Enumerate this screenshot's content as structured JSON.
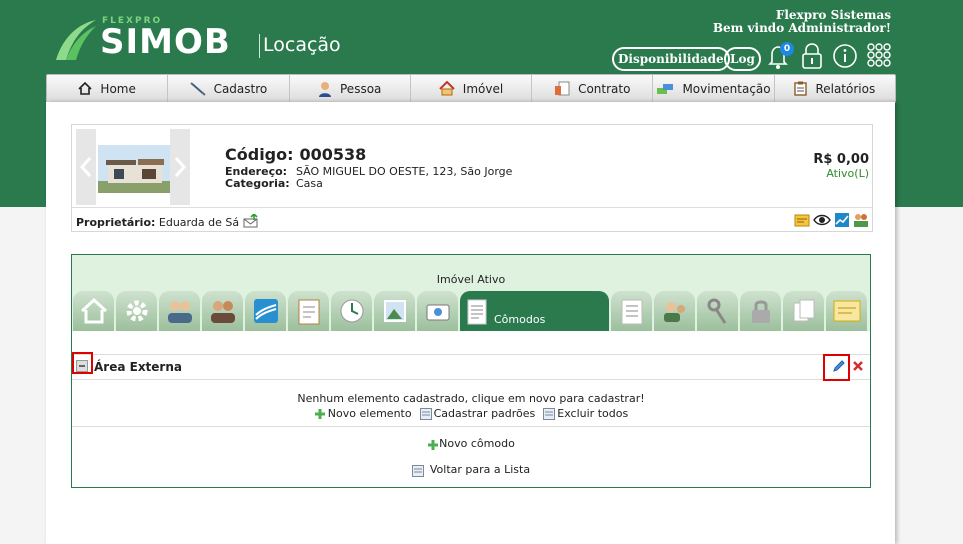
{
  "brand": {
    "flexpro": "FLEXPRO",
    "simob": "SIMOB",
    "locacao": "Locação"
  },
  "header": {
    "company": "Flexpro Sistemas",
    "welcome": "Bem vindo Administrador!",
    "disponibilidade": "Disponibilidade",
    "log": "Log",
    "notifications": "0"
  },
  "menu": [
    {
      "label": "Home",
      "icon": "home-icon"
    },
    {
      "label": "Cadastro",
      "icon": "feather-icon"
    },
    {
      "label": "Pessoa",
      "icon": "person-icon"
    },
    {
      "label": "Imóvel",
      "icon": "house-icon"
    },
    {
      "label": "Contrato",
      "icon": "contract-icon"
    },
    {
      "label": "Movimentação",
      "icon": "money-icon"
    },
    {
      "label": "Relatórios",
      "icon": "clipboard-icon"
    }
  ],
  "property": {
    "codigo_label": "Código:",
    "codigo": "000538",
    "endereco_label": "Endereço:",
    "endereco": "SÃO MIGUEL DO OESTE, 123, São Jorge",
    "categoria_label": "Categoria:",
    "categoria": "Casa",
    "price": "R$ 0,00",
    "status": "Ativo(L)",
    "owner_label": "Proprietário:",
    "owner": "Eduarda de Sá"
  },
  "panel": {
    "title": "Imóvel Ativo",
    "active_tab": "Cômodos",
    "section": "Área Externa",
    "empty_msg": "Nenhum elemento cadastrado, clique em novo para cadastrar!",
    "novo_elemento": "Novo elemento",
    "cadastrar_padroes": "Cadastrar padrões",
    "excluir_todos": "Excluir todos",
    "novo_comodo": "Novo cômodo",
    "voltar": "Voltar para a Lista"
  },
  "colors": {
    "brand_green": "#2a7a4e",
    "tab_bg": "#dff2df",
    "highlight": "#e00000"
  }
}
